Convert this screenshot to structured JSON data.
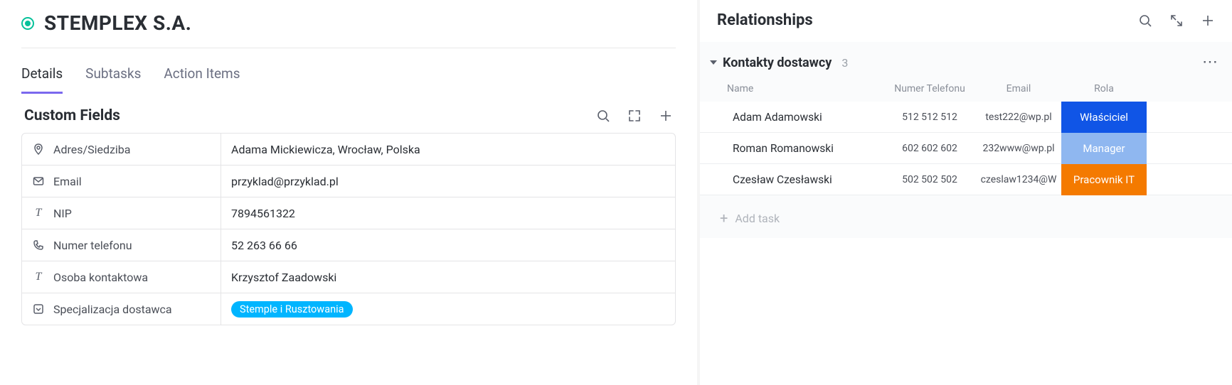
{
  "header": {
    "title": "STEMPLEX S.A."
  },
  "tabs": [
    {
      "label": "Details",
      "active": true
    },
    {
      "label": "Subtasks",
      "active": false
    },
    {
      "label": "Action Items",
      "active": false
    }
  ],
  "custom_fields": {
    "section_title": "Custom Fields",
    "rows": [
      {
        "icon": "location",
        "label": "Adres/Siedziba",
        "value": "Adama Mickiewicza, Wrocław, Polska"
      },
      {
        "icon": "email",
        "label": "Email",
        "value": "przyklad@przyklad.pl"
      },
      {
        "icon": "text",
        "label": "NIP",
        "value": "7894561322"
      },
      {
        "icon": "phone",
        "label": "Numer telefonu",
        "value": "52 263 66 66"
      },
      {
        "icon": "text",
        "label": "Osoba kontaktowa",
        "value": "Krzysztof Zaadowski"
      },
      {
        "icon": "dropdown",
        "label": "Specjalizacja dostawca",
        "tag": "Stemple i Rusztowania"
      }
    ]
  },
  "relationships": {
    "title": "Relationships",
    "group": {
      "title": "Kontakty dostawcy",
      "count": "3",
      "columns": {
        "name": "Name",
        "phone": "Numer Telefonu",
        "email": "Email",
        "role": "Rola"
      },
      "rows": [
        {
          "name": "Adam Adamowski",
          "phone": "512 512 512",
          "email": "test222@wp.pl",
          "role": "Właściciel",
          "role_class": "role-owner"
        },
        {
          "name": "Roman Romanowski",
          "phone": "602 602 602",
          "email": "232www@wp.pl",
          "role": "Manager",
          "role_class": "role-manager"
        },
        {
          "name": "Czesław Czesławski",
          "phone": "502 502 502",
          "email": "czeslaw1234@W",
          "role": "Pracownik IT",
          "role_class": "role-it"
        }
      ]
    },
    "add_task_label": "Add task"
  }
}
